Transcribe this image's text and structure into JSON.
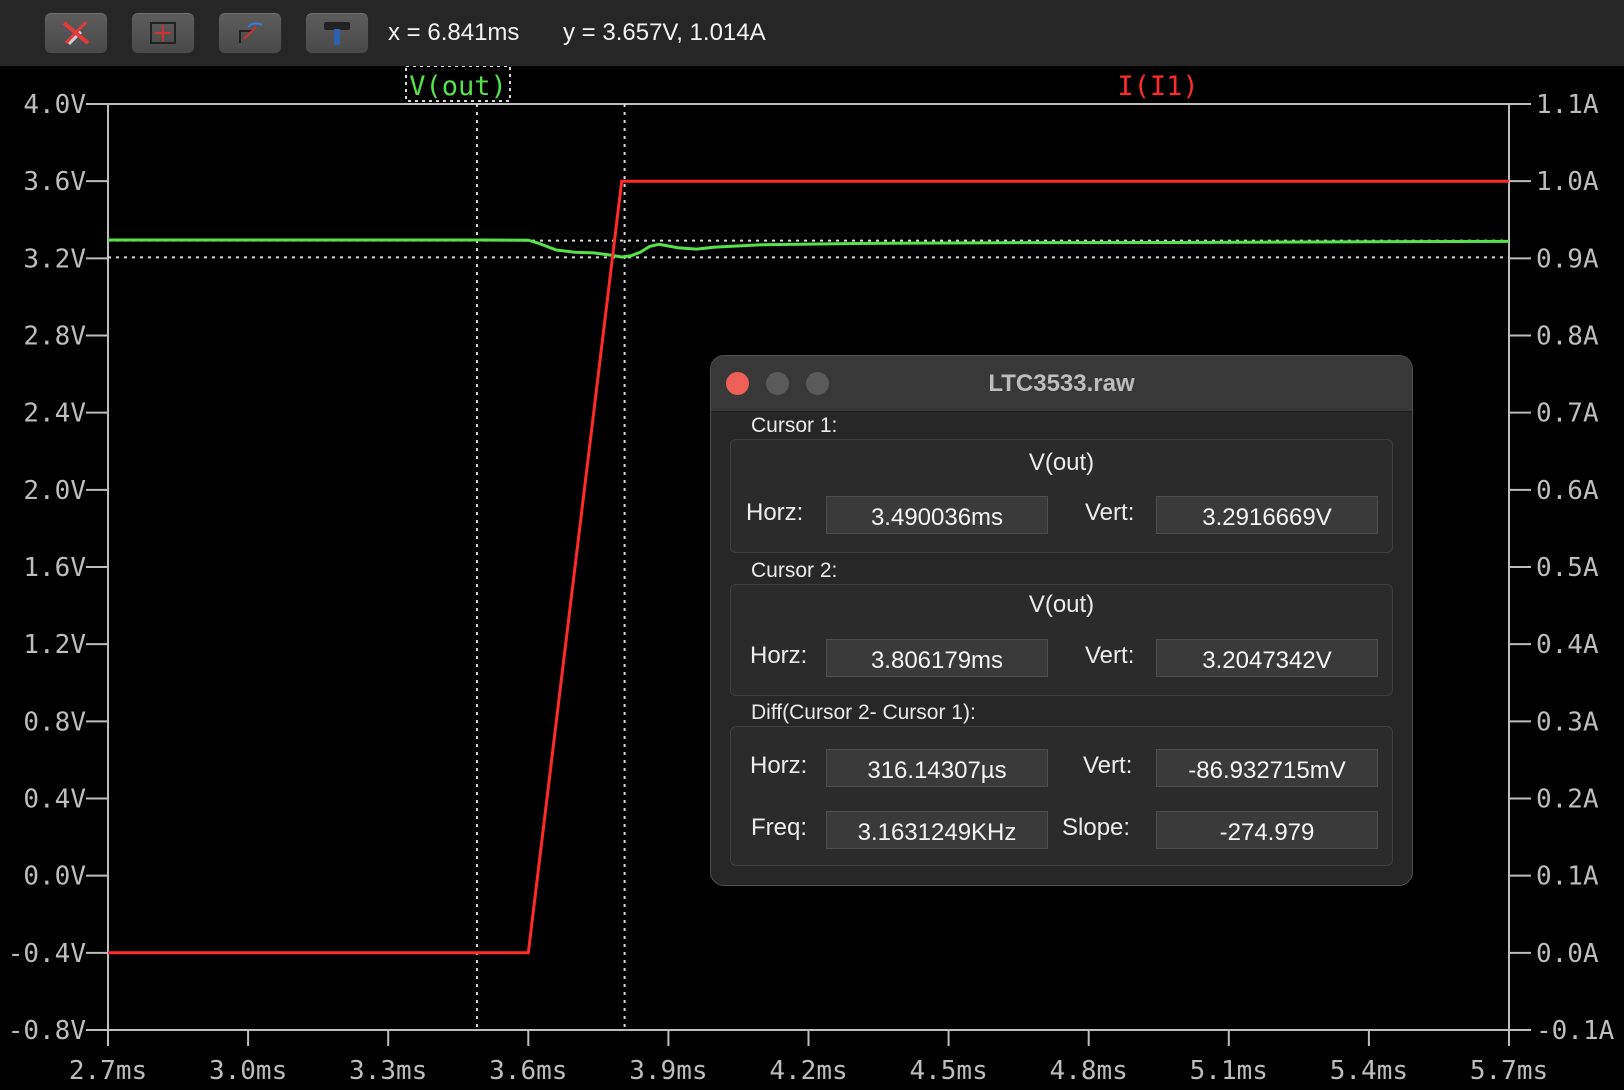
{
  "toolbar": {
    "buttons": [
      {
        "icon": "probe-cancel-icon"
      },
      {
        "icon": "zoom-extents-icon"
      },
      {
        "icon": "zoom-back-icon"
      },
      {
        "icon": "hammer-icon"
      }
    ],
    "x_readout": "x = 6.841ms",
    "y_readout": "y = 3.657V, 1.014A"
  },
  "chart_data": {
    "type": "line",
    "x_tick_labels": [
      "2.7ms",
      "3.0ms",
      "3.3ms",
      "3.6ms",
      "3.9ms",
      "4.2ms",
      "4.5ms",
      "4.8ms",
      "5.1ms",
      "5.4ms",
      "5.7ms"
    ],
    "y_left_tick_labels": [
      "4.0V",
      "3.6V",
      "3.2V",
      "2.8V",
      "2.4V",
      "2.0V",
      "1.6V",
      "1.2V",
      "0.8V",
      "0.4V",
      "0.0V",
      "-0.4V",
      "-0.8V"
    ],
    "y_right_tick_labels": [
      "1.1A",
      "1.0A",
      "0.9A",
      "0.8A",
      "0.7A",
      "0.6A",
      "0.5A",
      "0.4A",
      "0.3A",
      "0.2A",
      "0.1A",
      "0.0A",
      "-0.1A"
    ],
    "xlim_ms": [
      2.7,
      5.7
    ],
    "ylim_left_V": [
      -0.8,
      4.0
    ],
    "ylim_right_A": [
      -0.1,
      1.1
    ],
    "grid": false,
    "series": [
      {
        "name": "V(out)",
        "axis": "left",
        "color": "#55e24a",
        "x_ms": [
          2.7,
          3.4,
          3.5,
          3.6,
          3.62,
          3.66,
          3.7,
          3.74,
          3.78,
          3.8,
          3.82,
          3.84,
          3.86,
          3.88,
          3.92,
          3.96,
          4.0,
          4.1,
          4.3,
          4.6,
          5.0,
          5.4,
          5.7
        ],
        "y_V": [
          3.295,
          3.295,
          3.295,
          3.294,
          3.28,
          3.243,
          3.232,
          3.228,
          3.215,
          3.207,
          3.213,
          3.232,
          3.262,
          3.273,
          3.255,
          3.248,
          3.258,
          3.27,
          3.277,
          3.281,
          3.282,
          3.286,
          3.288
        ]
      },
      {
        "name": "I(I1)",
        "axis": "right",
        "color": "#ff2a2a",
        "x_ms": [
          2.7,
          3.6,
          3.8,
          5.7
        ],
        "y_A": [
          0.0,
          0.0,
          1.0,
          1.0
        ]
      }
    ],
    "cursors": [
      {
        "name": "Cursor 1",
        "x_ms": 3.490036,
        "y_V": 3.2916669
      },
      {
        "name": "Cursor 2",
        "x_ms": 3.806179,
        "y_V": 3.2047342
      }
    ]
  },
  "dialog": {
    "title": "LTC3533.raw",
    "cursor1": {
      "label": "Cursor 1:",
      "trace": "V(out)",
      "horz_label": "Horz:",
      "horz": "3.490036ms",
      "vert_label": "Vert:",
      "vert": "3.2916669V"
    },
    "cursor2": {
      "label": "Cursor 2:",
      "trace": "V(out)",
      "horz_label": "Horz:",
      "horz": "3.806179ms",
      "vert_label": "Vert:",
      "vert": "3.2047342V"
    },
    "diff": {
      "label": "Diff(Cursor 2- Cursor 1):",
      "horz_label": "Horz:",
      "horz": "316.14307µs",
      "vert_label": "Vert:",
      "vert": "-86.932715mV",
      "freq_label": "Freq:",
      "freq": "3.1631249KHz",
      "slope_label": "Slope:",
      "slope": "-274.979"
    }
  },
  "colors": {
    "vout": "#55e24a",
    "current": "#ff2a2a",
    "axes": "#bdbdbd",
    "close": "#ee5f57",
    "inactive_light": "#5a5a5a"
  }
}
